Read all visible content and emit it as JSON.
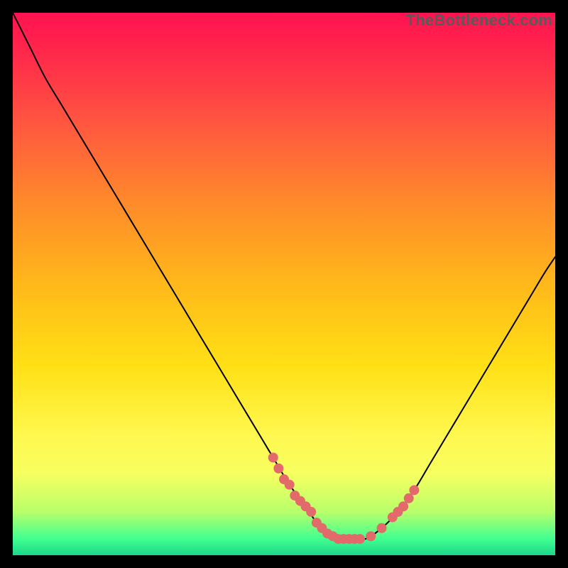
{
  "watermark": "TheBottleneck.com",
  "colors": {
    "curve": "#000000",
    "marker": "#e26a6a",
    "background_top": "#ff1250",
    "background_bottom": "#1dd68a"
  },
  "chart_data": {
    "type": "line",
    "title": "",
    "xlabel": "",
    "ylabel": "",
    "xlim": [
      0,
      100
    ],
    "ylim": [
      0,
      100
    ],
    "grid": false,
    "legend": false,
    "annotations": [
      "TheBottleneck.com"
    ],
    "series": [
      {
        "name": "bottleneck_curve",
        "x": [
          0,
          3,
          6,
          9,
          12,
          15,
          18,
          21,
          24,
          27,
          30,
          33,
          36,
          39,
          42,
          45,
          48,
          51,
          54,
          56,
          58,
          60,
          62,
          65,
          68,
          71,
          74,
          77,
          80,
          83,
          86,
          89,
          92,
          95,
          98,
          100
        ],
        "y": [
          100,
          94,
          88,
          83,
          78,
          73,
          68,
          63,
          58,
          53,
          48,
          43,
          38,
          33,
          28,
          23,
          18,
          13,
          9,
          6,
          4,
          3,
          3,
          3,
          5,
          8,
          12,
          17,
          22,
          27,
          32,
          37,
          42,
          47,
          52,
          55
        ]
      }
    ],
    "markers": {
      "name": "highlight_points",
      "color": "#e26a6a",
      "radius": 7,
      "x": [
        48,
        49,
        50,
        51,
        52,
        53,
        54,
        55,
        56,
        57,
        58,
        59,
        60,
        61,
        62,
        63,
        64,
        66,
        68,
        70,
        71,
        72,
        73,
        74
      ],
      "y": [
        18,
        16,
        14,
        13,
        11,
        10,
        9,
        8,
        6,
        5,
        4,
        3.5,
        3,
        3,
        3,
        3,
        3,
        3.5,
        5,
        7,
        8,
        9,
        10.5,
        12
      ]
    }
  }
}
